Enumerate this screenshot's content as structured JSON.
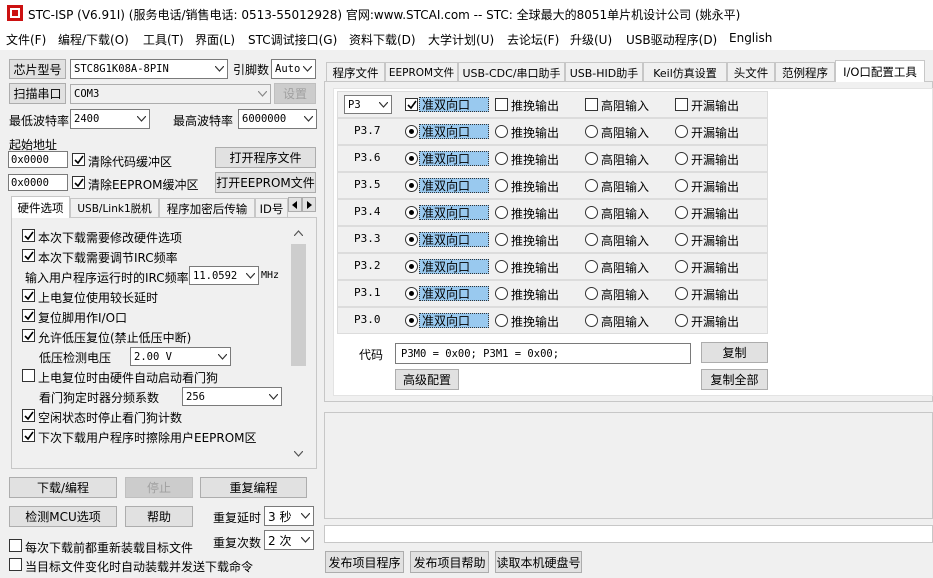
{
  "window": {
    "title": "STC-ISP (V6.91I) (服务电话/销售电话: 0513-55012928) 官网:www.STCAI.com  -- STC: 全球最大的8051单片机设计公司 (姚永平)"
  },
  "menu": [
    "文件(F)",
    "编程/下载(O)",
    "工具(T)",
    "界面(L)",
    "STC调试接口(G)",
    "资料下载(D)",
    "大学计划(U)",
    "去论坛(F)",
    "升级(U)",
    "USB驱动程序(D)",
    "English"
  ],
  "left": {
    "chip_button": "芯片型号",
    "chip_value": "STC8G1K08A-8PIN",
    "pin_label": "引脚数",
    "pin_value": "Auto",
    "scan_button": "扫描串口",
    "port_value": "COM3",
    "settings_button": "设置",
    "min_baud_label": "最低波特率",
    "min_baud_value": "2400",
    "max_baud_label": "最高波特率",
    "max_baud_value": "6000000",
    "start_addr_label": "起始地址",
    "addr1": "0x0000",
    "clear_code": "清除代码缓冲区",
    "open_prog": "打开程序文件",
    "addr2": "0x0000",
    "clear_eeprom": "清除EEPROM缓冲区",
    "open_eeprom": "打开EEPROM文件",
    "tabs": [
      "硬件选项",
      "USB/Link1脱机",
      "程序加密后传输",
      "ID号"
    ],
    "options": {
      "opt1": "本次下载需要修改硬件选项",
      "opt2": "本次下载需要调节IRC频率",
      "irc_label": "输入用户程序运行时的IRC频率",
      "irc_value": "11.0592",
      "irc_unit": "MHz",
      "opt3": "上电复位使用较长延时",
      "opt4": "复位脚用作I/O口",
      "opt5": "允许低压复位(禁止低压中断)",
      "lvd_label": "低压检测电压",
      "lvd_value": "2.00 V",
      "opt6": "上电复位时由硬件自动启动看门狗",
      "wdt_label": "看门狗定时器分频系数",
      "wdt_value": "256",
      "opt7": "空闲状态时停止看门狗计数",
      "opt8": "下次下载用户程序时擦除用户EEPROM区"
    },
    "download_button": "下载/编程",
    "stop_button": "停止",
    "reprogram_button": "重复编程",
    "detect_button": "检测MCU选项",
    "help_button": "帮助",
    "repeat_delay_label": "重复延时",
    "repeat_delay_value": "3 秒",
    "repeat_count_label": "重复次数",
    "repeat_count_value": "2 次",
    "reload_each": "每次下载前都重新装载目标文件",
    "auto_load": "当目标文件变化时自动装载并发送下载命令"
  },
  "right": {
    "tabs": [
      "程序文件",
      "EEPROM文件",
      "USB-CDC/串口助手",
      "USB-HID助手",
      "Keil仿真设置",
      "头文件",
      "范例程序",
      "I/O口配置工具"
    ],
    "port_select": "P3",
    "col_quasi": "准双向口",
    "col_push": "推挽输出",
    "col_hiz": "高阻输入",
    "col_od": "开漏输出",
    "pins": [
      "P3.7",
      "P3.6",
      "P3.5",
      "P3.4",
      "P3.3",
      "P3.2",
      "P3.1",
      "P3.0"
    ],
    "code_label": "代码",
    "code_value": "P3M0 = 0x00;  P3M1 = 0x00;",
    "copy_button": "复制",
    "advanced_button": "高级配置",
    "copy_all_button": "复制全部",
    "publish_button": "发布项目程序",
    "publish_help_button": "发布项目帮助",
    "read_disk_button": "读取本机硬盘号"
  }
}
